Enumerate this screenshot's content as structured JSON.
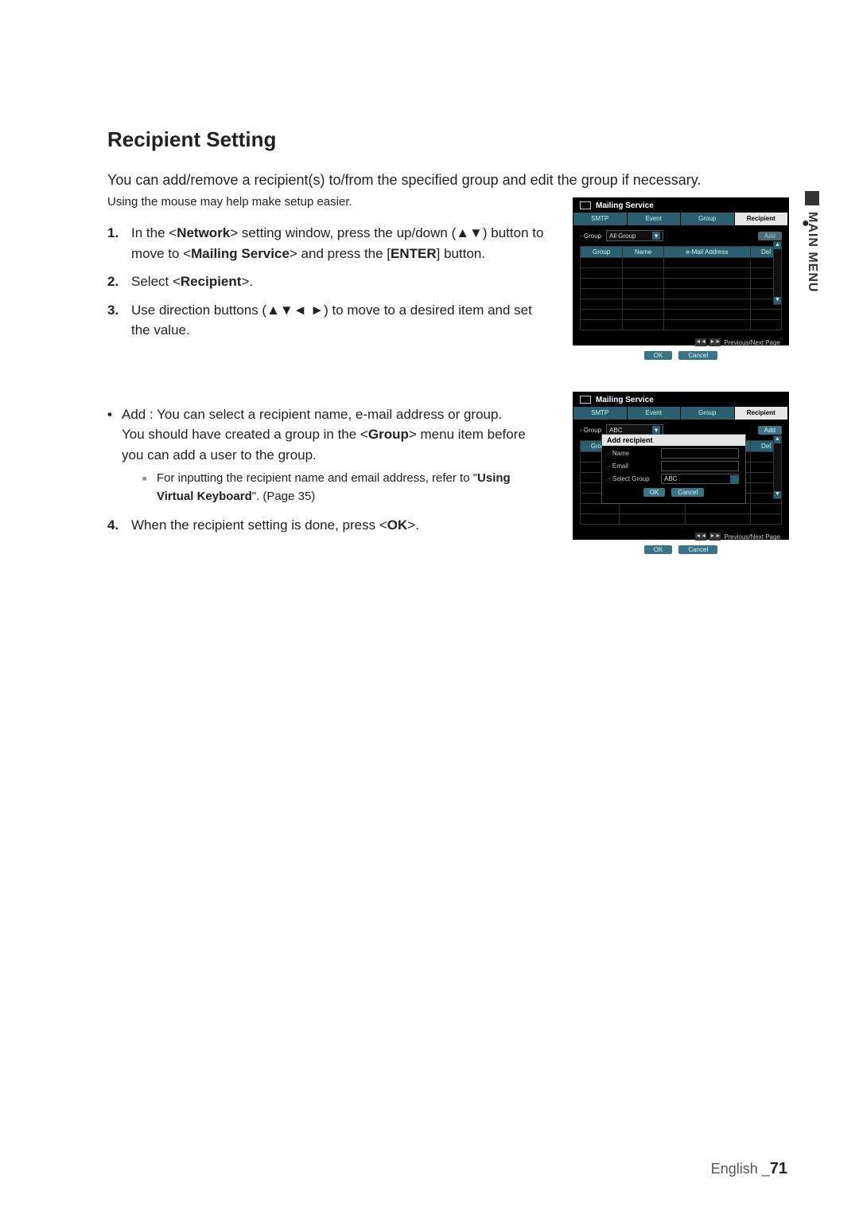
{
  "title": "Recipient Setting",
  "intro": "You can add/remove a recipient(s) to/from the specified group and edit the group if necessary.",
  "note": "Using the mouse may help make setup easier.",
  "steps": {
    "s1_pre": "In the <",
    "s1_b1": "Network",
    "s1_mid1": "> setting window, press the up/down (▲▼) button to move to <",
    "s1_b2": "Mailing Service",
    "s1_mid2": "> and press the [",
    "s1_b3": "ENTER",
    "s1_post": "] button.",
    "s2_pre": "Select <",
    "s2_b": "Recipient",
    "s2_post": ">.",
    "s3": "Use direction buttons (▲▼◄ ►) to move to a desired item and set the value.",
    "s4_pre": "When the recipient setting is done, press <",
    "s4_b": "OK",
    "s4_post": ">."
  },
  "bullet": {
    "l1": "Add : You can select a recipient name, e-mail address or group.",
    "l2_pre": "You should have created a group in the <",
    "l2_b": "Group",
    "l2_post": "> menu item before you can add a user to the group.",
    "sub_pre": "For inputting the recipient name and email address, refer to \"",
    "sub_b": "Using Virtual Keyboard",
    "sub_post": "\". (Page 35)"
  },
  "sidetab": "MAIN MENU",
  "footer_lang": "English _",
  "footer_page": "71",
  "mock": {
    "window_title": "Mailing Service",
    "tabs": {
      "smtp": "SMTP",
      "event": "Event",
      "group": "Group",
      "recipient": "Recipient"
    },
    "group_label": "· Group",
    "group_value": "All Group",
    "group_value2": "ABC",
    "add": "Add",
    "del": "Del",
    "th_group": "Group",
    "th_name": "Name",
    "th_email": "e-Mail Address",
    "th_del": "Del",
    "pager": "Previous/Next Page",
    "ok": "OK",
    "cancel": "Cancel",
    "popup_title": "Add recipient",
    "p_name": "· Name",
    "p_email": "· Email",
    "p_select_group": "· Select Group",
    "p_select_group_val": "ABC"
  }
}
